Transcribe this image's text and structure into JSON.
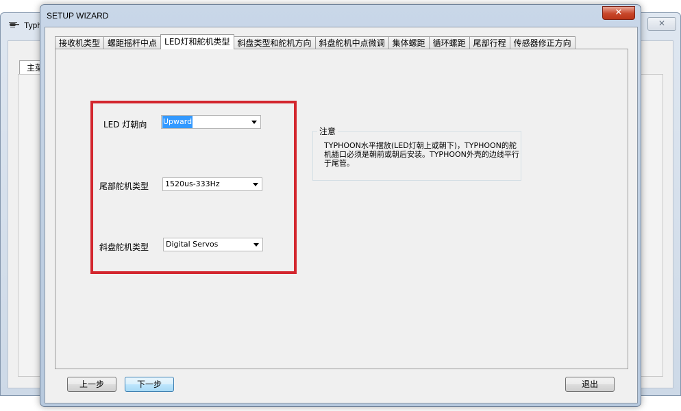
{
  "background_window": {
    "title": "Typh",
    "close_glyph": "✕",
    "tab_label": "主菜",
    "icon": "helicopter-icon"
  },
  "dialog": {
    "title": "SETUP WIZARD",
    "close_glyph": "✕"
  },
  "tabs": [
    {
      "label": "接收机类型",
      "active": false
    },
    {
      "label": "螺距摇杆中点",
      "active": false
    },
    {
      "label": "LED灯和舵机类型",
      "active": true
    },
    {
      "label": "斜盘类型和舵机方向",
      "active": false
    },
    {
      "label": "斜盘舵机中点微调",
      "active": false
    },
    {
      "label": "集体螺距",
      "active": false
    },
    {
      "label": "循环螺距",
      "active": false
    },
    {
      "label": "尾部行程",
      "active": false
    },
    {
      "label": "传感器修正方向",
      "active": false
    }
  ],
  "fields": {
    "led_orientation": {
      "label": "LED 灯朝向",
      "value": "Upward"
    },
    "tail_servo_type": {
      "label": "尾部舵机类型",
      "value": "1520us-333Hz"
    },
    "swash_servo_type": {
      "label": "斜盘舵机类型",
      "value": "Digital Servos"
    }
  },
  "note": {
    "title": "注意",
    "text": "TYPHOON水平摆放(LED灯朝上或朝下)，TYPHOON的舵机插口必须是朝前或朝后安装。TYPHOON外壳的边线平行于尾管。"
  },
  "buttons": {
    "prev": "上一步",
    "next": "下一步",
    "exit": "退出"
  },
  "colors": {
    "highlight_frame": "#d3262e",
    "selection": "#3399ff",
    "close_button": "#c8462a"
  }
}
